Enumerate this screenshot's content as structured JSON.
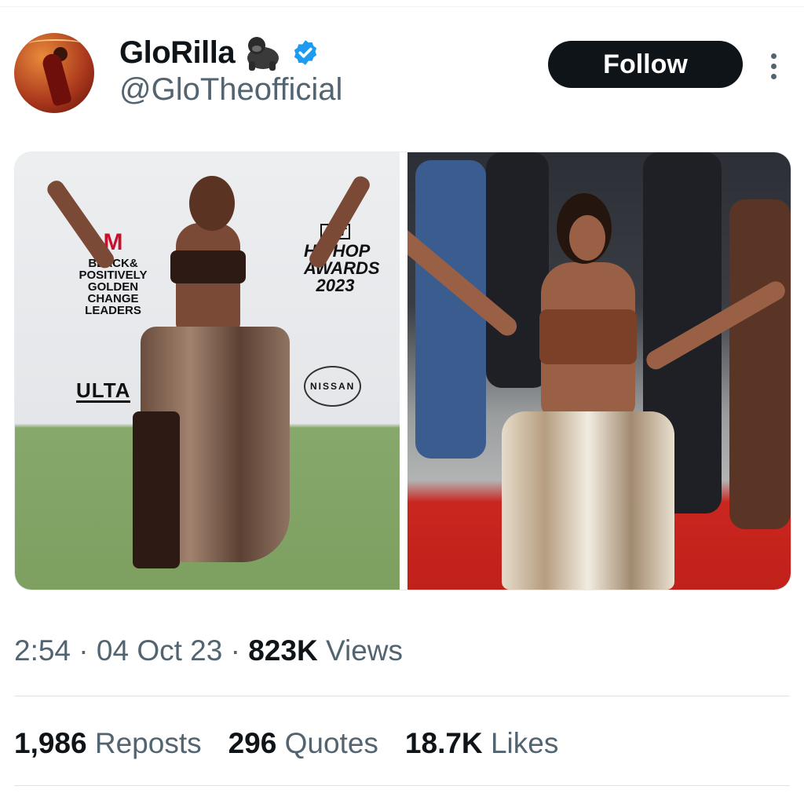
{
  "profile": {
    "display_name": "GloRilla",
    "handle": "@GloTheofficial",
    "verified": true,
    "badge_emoji": "gorilla-icon"
  },
  "actions": {
    "follow_label": "Follow",
    "more_icon": "more-vertical-icon"
  },
  "media": {
    "images": [
      {
        "label": "left-photo",
        "backdrop_text": [
          "BLACK& POSITIVELY GOLDEN CHANGE LEADERS",
          "HIPHOP AWARDS 2023",
          "ULTA",
          "NISSAN"
        ],
        "backdrop_m": "M",
        "bet": "BET"
      },
      {
        "label": "right-photo"
      }
    ]
  },
  "tweet_meta": {
    "time": "2:54",
    "date": "04 Oct 23",
    "views_count": "823K",
    "views_label": "Views",
    "sep": "·"
  },
  "stats": [
    {
      "count": "1,986",
      "label": "Reposts"
    },
    {
      "count": "296",
      "label": "Quotes"
    },
    {
      "count": "18.7K",
      "label": "Likes"
    }
  ],
  "colors": {
    "text_primary": "#0f1419",
    "text_secondary": "#536471",
    "verified": "#1d9bf0",
    "follow_bg": "#0f1419"
  }
}
